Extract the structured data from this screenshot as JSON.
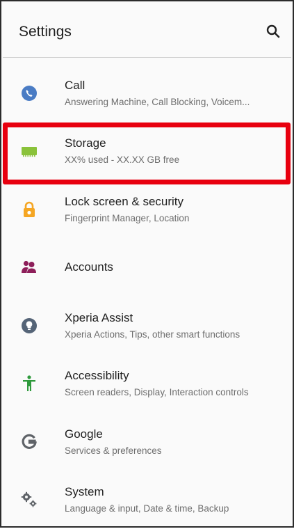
{
  "header": {
    "title": "Settings",
    "search_icon": "search-icon"
  },
  "settings": [
    {
      "key": "call",
      "label": "Call",
      "summary": "Answering Machine, Call Blocking, Voicem...",
      "icon": "phone-icon",
      "color": "#4a7cc4"
    },
    {
      "key": "storage",
      "label": "Storage",
      "summary": "XX% used - XX.XX GB free",
      "icon": "storage-icon",
      "color": "#8ac23a"
    },
    {
      "key": "lock-screen",
      "label": "Lock screen & security",
      "summary": "Fingerprint Manager, Location",
      "icon": "lock-icon",
      "color": "#f5a623"
    },
    {
      "key": "accounts",
      "label": "Accounts",
      "summary": "",
      "icon": "accounts-icon",
      "color": "#8e1f5a"
    },
    {
      "key": "xperia-assist",
      "label": "Xperia Assist",
      "summary": "Xperia Actions, Tips, other smart functions",
      "icon": "lightbulb-icon",
      "color": "#556477"
    },
    {
      "key": "accessibility",
      "label": "Accessibility",
      "summary": "Screen readers, Display, Interaction controls",
      "icon": "accessibility-icon",
      "color": "#2e9a3c"
    },
    {
      "key": "google",
      "label": "Google",
      "summary": "Services & preferences",
      "icon": "google-icon",
      "color": "#5f6368"
    },
    {
      "key": "system",
      "label": "System",
      "summary": "Language & input, Date & time, Backup",
      "icon": "system-gears-icon",
      "color": "#5f6368"
    }
  ],
  "highlight": {
    "target": "storage",
    "color": "#e8000f"
  }
}
